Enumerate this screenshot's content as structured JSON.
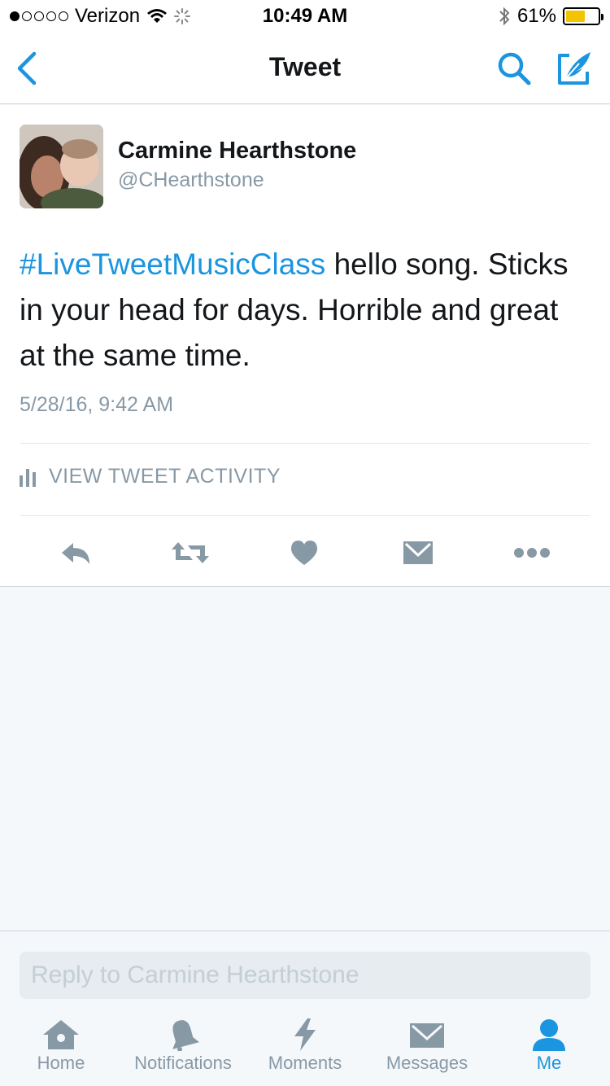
{
  "status_bar": {
    "carrier": "Verizon",
    "time": "10:49 AM",
    "battery_percent": "61%",
    "battery_level": 0.61
  },
  "nav": {
    "title": "Tweet",
    "back_icon": "chevron-left-icon",
    "search_icon": "search-icon",
    "compose_icon": "compose-icon"
  },
  "tweet": {
    "author_name": "Carmine Hearthstone",
    "author_handle": "@CHearthstone",
    "hashtag": "#LiveTweetMusicClass",
    "text": " hello song. Sticks in your head for days. Horrible and great at the same time.",
    "timestamp": "5/28/16, 9:42 AM",
    "activity_label": "VIEW TWEET ACTIVITY",
    "actions": [
      "reply-icon",
      "retweet-icon",
      "heart-icon",
      "envelope-icon",
      "more-icon"
    ]
  },
  "reply": {
    "placeholder": "Reply to Carmine Hearthstone"
  },
  "tabs": [
    {
      "label": "Home",
      "icon": "home-icon"
    },
    {
      "label": "Notifications",
      "icon": "bell-icon"
    },
    {
      "label": "Moments",
      "icon": "lightning-icon"
    },
    {
      "label": "Messages",
      "icon": "envelope-icon"
    },
    {
      "label": "Me",
      "icon": "person-icon"
    }
  ],
  "colors": {
    "accent": "#1b95e0",
    "icon_gray": "#8899a6",
    "background": "#f5f8fa"
  }
}
